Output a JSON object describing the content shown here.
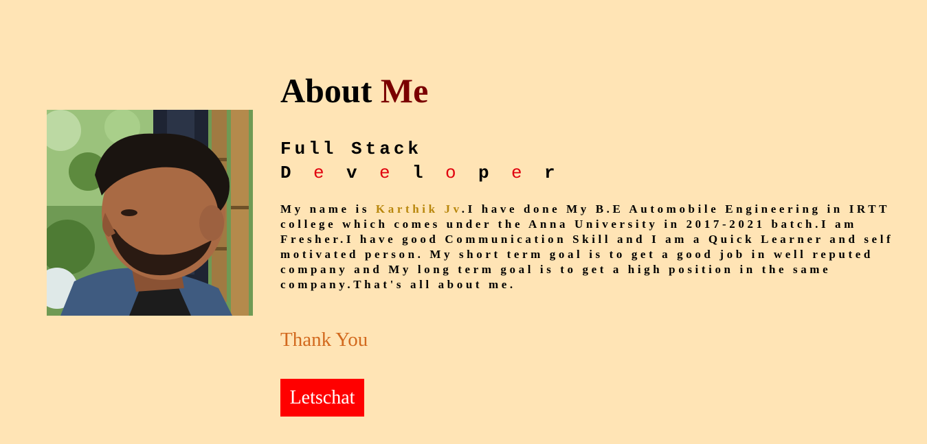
{
  "about": {
    "title_part1": "About",
    "title_part2": "Me"
  },
  "subtitle": {
    "line1": "Full Stack",
    "line2_letters": [
      "D",
      "e",
      "v",
      "e",
      "l",
      "o",
      "p",
      "e",
      "r"
    ]
  },
  "bio": {
    "intro": "My name is ",
    "name": "Karthik Jv",
    "rest": ".I have done My B.E Automobile Engineering in IRTT college which comes under the Anna University in 2017-2021 batch.I am Fresher.I have good Communication Skill and I am a Quick Learner and self motivated person. My short term goal is to get a good job in well reputed company and My long term goal is to get a high position in the same company.That's all about me."
  },
  "thanks": "Thank You",
  "button": {
    "label": "Letschat"
  },
  "colors": {
    "background": "#ffe4b5",
    "title_accent": "#7a0000",
    "name_highlight": "#b8860b",
    "thanks": "#d2691e",
    "button_bg": "#ff0000",
    "developer_alt_letter": "#e0000e"
  }
}
